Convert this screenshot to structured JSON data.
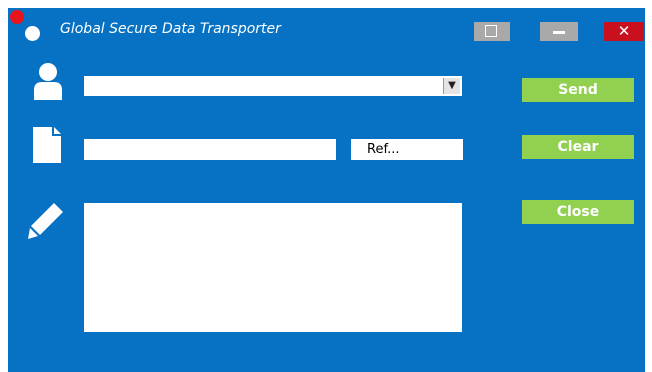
{
  "window": {
    "title": "Global Secure Data Transporter",
    "controls": {
      "maximize_icon": "maximize-icon",
      "minimize_icon": "minimize-icon",
      "close_label": "✕"
    }
  },
  "colors": {
    "background": "#0772c3",
    "accent_button": "#92d050",
    "close_control": "#c8101e",
    "logo_red": "#e8141c"
  },
  "form": {
    "recipient": {
      "icon": "user-icon",
      "value": ""
    },
    "file": {
      "icon": "file-icon",
      "path_value": "",
      "browse_label": "Ref..."
    },
    "message": {
      "icon": "pencil-icon",
      "value": ""
    }
  },
  "actions": {
    "send_label": "Send",
    "clear_label": "Clear",
    "close_label": "Close"
  }
}
